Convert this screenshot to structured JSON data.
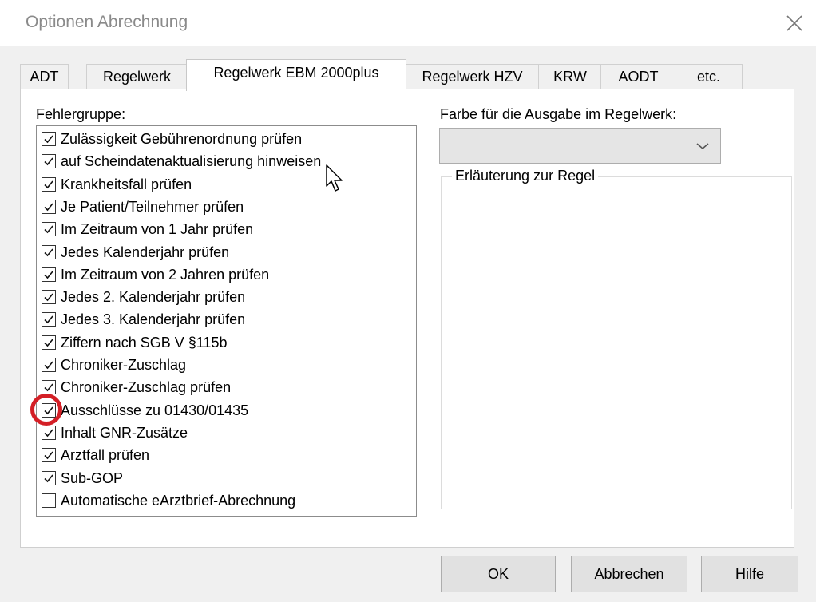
{
  "window": {
    "title": "Optionen Abrechnung",
    "close_icon": "close-icon"
  },
  "tabs": [
    {
      "label": "ADT",
      "active": false
    },
    {
      "label": "Regelwerk",
      "active": false
    },
    {
      "label": "Regelwerk EBM 2000plus",
      "active": true
    },
    {
      "label": "Regelwerk HZV",
      "active": false
    },
    {
      "label": "KRW",
      "active": false
    },
    {
      "label": "AODT",
      "active": false
    },
    {
      "label": "etc.",
      "active": false
    }
  ],
  "fehlergruppe": {
    "label": "Fehlergruppe:",
    "items": [
      {
        "label": "Zulässigkeit Gebührenordnung prüfen",
        "checked": true
      },
      {
        "label": "auf Scheindatenaktualisierung hinweisen",
        "checked": true
      },
      {
        "label": "Krankheitsfall prüfen",
        "checked": true
      },
      {
        "label": "Je Patient/Teilnehmer prüfen",
        "checked": true
      },
      {
        "label": "Im Zeitraum von 1 Jahr prüfen",
        "checked": true
      },
      {
        "label": "Jedes Kalenderjahr prüfen",
        "checked": true
      },
      {
        "label": "Im Zeitraum von 2 Jahren prüfen",
        "checked": true
      },
      {
        "label": "Jedes 2. Kalenderjahr prüfen",
        "checked": true
      },
      {
        "label": "Jedes 3. Kalenderjahr prüfen",
        "checked": true
      },
      {
        "label": "Ziffern nach SGB V §115b",
        "checked": true
      },
      {
        "label": "Chroniker-Zuschlag",
        "checked": true
      },
      {
        "label": "Chroniker-Zuschlag prüfen",
        "checked": true
      },
      {
        "label": "Ausschlüsse zu 01430/01435",
        "checked": true
      },
      {
        "label": "Inhalt GNR-Zusätze",
        "checked": true
      },
      {
        "label": "Arztfall prüfen",
        "checked": true
      },
      {
        "label": "Sub-GOP",
        "checked": true
      },
      {
        "label": "Automatische eArztbrief-Abrechnung",
        "checked": false
      }
    ]
  },
  "farbe": {
    "label": "Farbe für die Ausgabe im Regelwerk:",
    "value": ""
  },
  "erlaeuterung": {
    "title": "Erläuterung zur Regel",
    "text": ""
  },
  "buttons": {
    "ok": "OK",
    "cancel": "Abbrechen",
    "help": "Hilfe"
  },
  "colors": {
    "annotation": "#d41f26",
    "combo_bg": "#e5e5e5",
    "dialog_bg": "#f0f0f0"
  }
}
